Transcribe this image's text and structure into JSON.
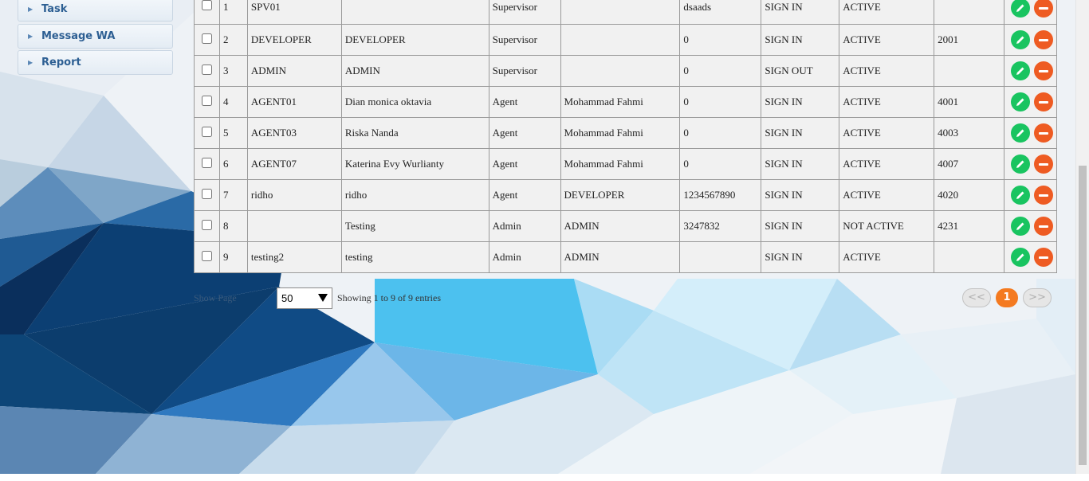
{
  "sidebar": {
    "items": [
      {
        "label": "Task"
      },
      {
        "label": "Message WA"
      },
      {
        "label": "Report"
      }
    ]
  },
  "table": {
    "rows": [
      {
        "no": "1",
        "username": "SPV01",
        "name": "",
        "level": "Supervisor",
        "supervisor": "",
        "phone": "dsaads",
        "login_status": "SIGN IN",
        "status": "ACTIVE",
        "extension": ""
      },
      {
        "no": "2",
        "username": "DEVELOPER",
        "name": "DEVELOPER",
        "level": "Supervisor",
        "supervisor": "",
        "phone": "0",
        "login_status": "SIGN IN",
        "status": "ACTIVE",
        "extension": "2001"
      },
      {
        "no": "3",
        "username": "ADMIN",
        "name": "ADMIN",
        "level": "Supervisor",
        "supervisor": "",
        "phone": "0",
        "login_status": "SIGN OUT",
        "status": "ACTIVE",
        "extension": ""
      },
      {
        "no": "4",
        "username": "AGENT01",
        "name": "Dian monica oktavia",
        "level": "Agent",
        "supervisor": "Mohammad Fahmi",
        "phone": "0",
        "login_status": "SIGN IN",
        "status": "ACTIVE",
        "extension": "4001"
      },
      {
        "no": "5",
        "username": "AGENT03",
        "name": "Riska Nanda",
        "level": "Agent",
        "supervisor": "Mohammad Fahmi",
        "phone": "0",
        "login_status": "SIGN IN",
        "status": "ACTIVE",
        "extension": "4003"
      },
      {
        "no": "6",
        "username": "AGENT07",
        "name": "Katerina Evy Wurlianty",
        "level": "Agent",
        "supervisor": "Mohammad Fahmi",
        "phone": "0",
        "login_status": "SIGN IN",
        "status": "ACTIVE",
        "extension": "4007"
      },
      {
        "no": "7",
        "username": "ridho",
        "name": "ridho",
        "level": "Agent",
        "supervisor": "DEVELOPER",
        "phone": "1234567890",
        "login_status": "SIGN IN",
        "status": "ACTIVE",
        "extension": "4020"
      },
      {
        "no": "8",
        "username": "",
        "name": "Testing",
        "level": "Admin",
        "supervisor": "ADMIN",
        "phone": "3247832",
        "login_status": "SIGN IN",
        "status": "NOT ACTIVE",
        "extension": "4231"
      },
      {
        "no": "9",
        "username": "testing2",
        "name": "testing",
        "level": "Admin",
        "supervisor": "ADMIN",
        "phone": "",
        "login_status": "SIGN IN",
        "status": "ACTIVE",
        "extension": ""
      }
    ]
  },
  "footer": {
    "show_label": "Show Page",
    "page_size": "50",
    "info": "Showing 1 to 9 of 9 entries"
  },
  "pagination": {
    "prev": "<<",
    "current": "1",
    "next": ">>"
  },
  "colors": {
    "edit": "#19c460",
    "delete": "#ee5b22",
    "current_page": "#f47a20"
  },
  "icons": {
    "edit": "pencil-icon",
    "delete": "minus-icon",
    "nav": "chevron-right-icon"
  }
}
